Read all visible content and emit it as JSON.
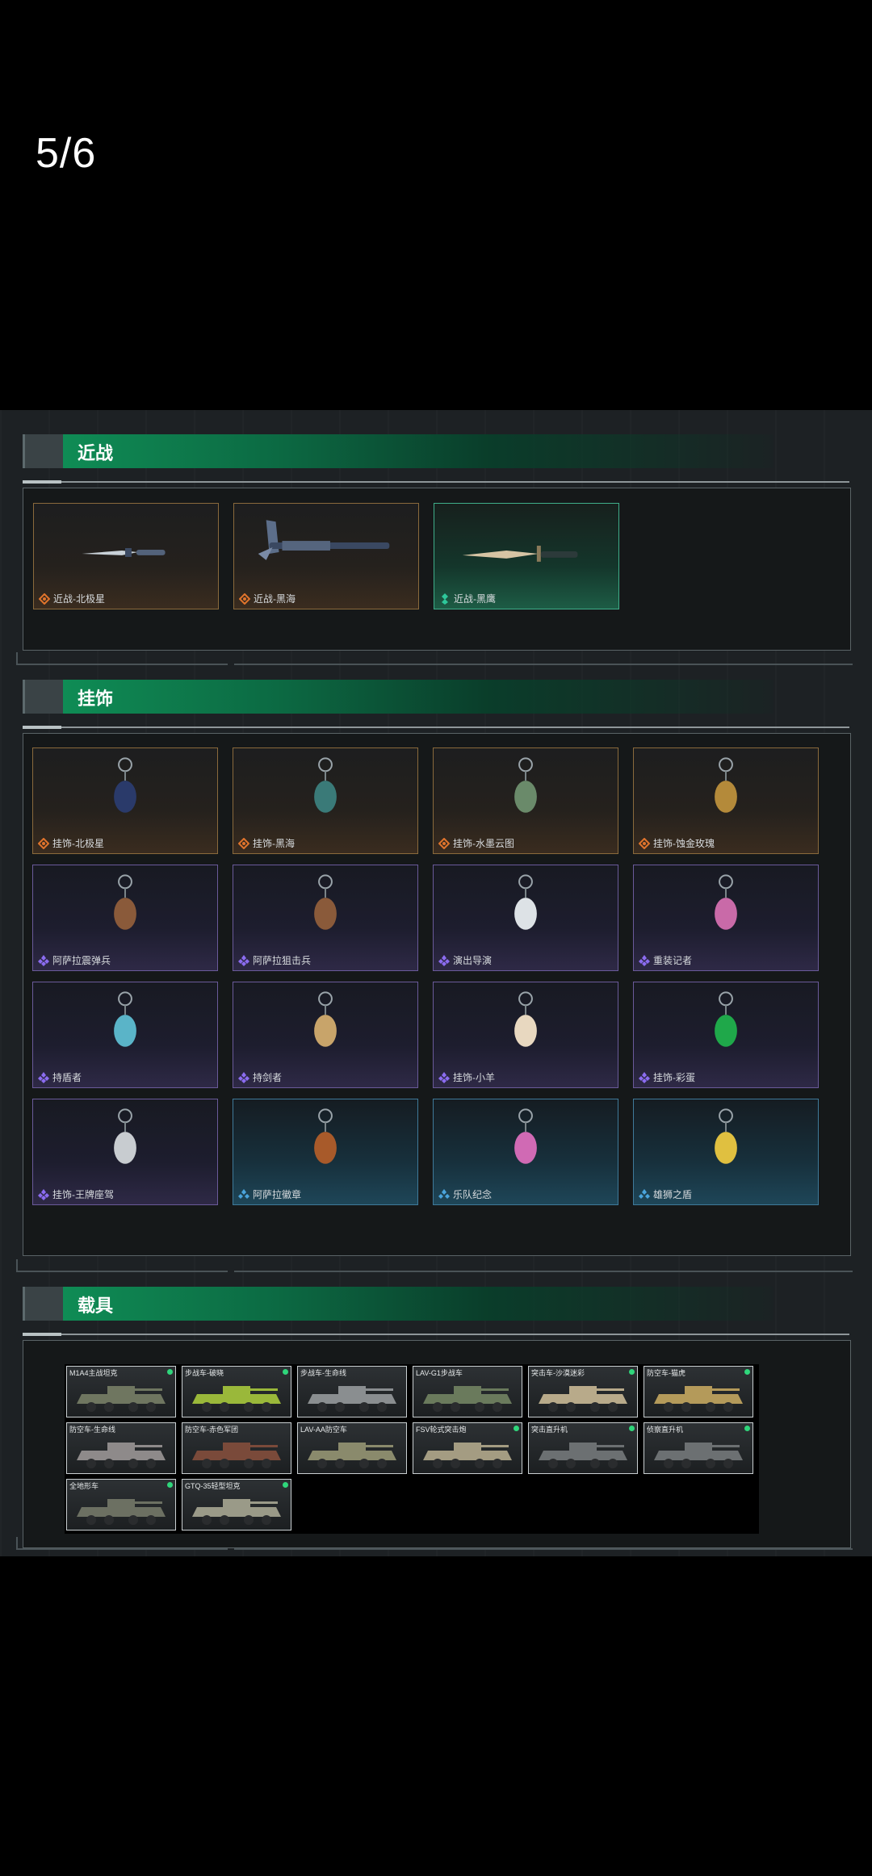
{
  "page_counter": "5/6",
  "sections": {
    "melee": {
      "title": "近战",
      "items": [
        {
          "label": "近战-北极星",
          "rarity": "orange"
        },
        {
          "label": "近战-黑海",
          "rarity": "orange"
        },
        {
          "label": "近战-黑鹰",
          "rarity": "teal"
        }
      ]
    },
    "charms": {
      "title": "挂饰",
      "items": [
        {
          "label": "挂饰-北极星",
          "rarity": "orange"
        },
        {
          "label": "挂饰-黑海",
          "rarity": "orange"
        },
        {
          "label": "挂饰-水墨云图",
          "rarity": "orange"
        },
        {
          "label": "挂饰-蚀金玫瑰",
          "rarity": "orange"
        },
        {
          "label": "阿萨拉震弹兵",
          "rarity": "purple"
        },
        {
          "label": "阿萨拉狙击兵",
          "rarity": "purple"
        },
        {
          "label": "演出导演",
          "rarity": "purple"
        },
        {
          "label": "重装记者",
          "rarity": "purple"
        },
        {
          "label": "持盾者",
          "rarity": "purple"
        },
        {
          "label": "持剑者",
          "rarity": "purple"
        },
        {
          "label": "挂饰-小羊",
          "rarity": "purple"
        },
        {
          "label": "挂饰-彩蛋",
          "rarity": "purple"
        },
        {
          "label": "挂饰-王牌座驾",
          "rarity": "purple"
        },
        {
          "label": "阿萨拉徽章",
          "rarity": "blue"
        },
        {
          "label": "乐队纪念",
          "rarity": "blue"
        },
        {
          "label": "雄狮之盾",
          "rarity": "blue"
        }
      ]
    },
    "vehicles": {
      "title": "载具",
      "items": [
        {
          "label": "M1A4主战坦克",
          "dot": true
        },
        {
          "label": "步战车-破晓",
          "dot": true
        },
        {
          "label": "步战车-生命线",
          "dot": false
        },
        {
          "label": "LAV-G1步战车",
          "dot": false
        },
        {
          "label": "突击车-沙漠迷彩",
          "dot": true
        },
        {
          "label": "防空车-猫虎",
          "dot": true
        },
        {
          "label": "防空车-生命线",
          "dot": false
        },
        {
          "label": "防空车-赤色军团",
          "dot": false
        },
        {
          "label": "LAV-AA防空车",
          "dot": false
        },
        {
          "label": "FSV轮式突击炮",
          "dot": true
        },
        {
          "label": "突击直升机",
          "dot": true
        },
        {
          "label": "侦察直升机",
          "dot": true
        },
        {
          "label": "全地形车",
          "dot": true
        },
        {
          "label": "GTQ-35轻型坦克",
          "dot": true
        }
      ]
    }
  },
  "colors": {
    "orange_rarity": "#e0742c",
    "teal_rarity": "#2ec79a",
    "purple_rarity": "#8b6cf0",
    "blue_rarity": "#4aa4dc",
    "header_green": "#0f8c55"
  }
}
